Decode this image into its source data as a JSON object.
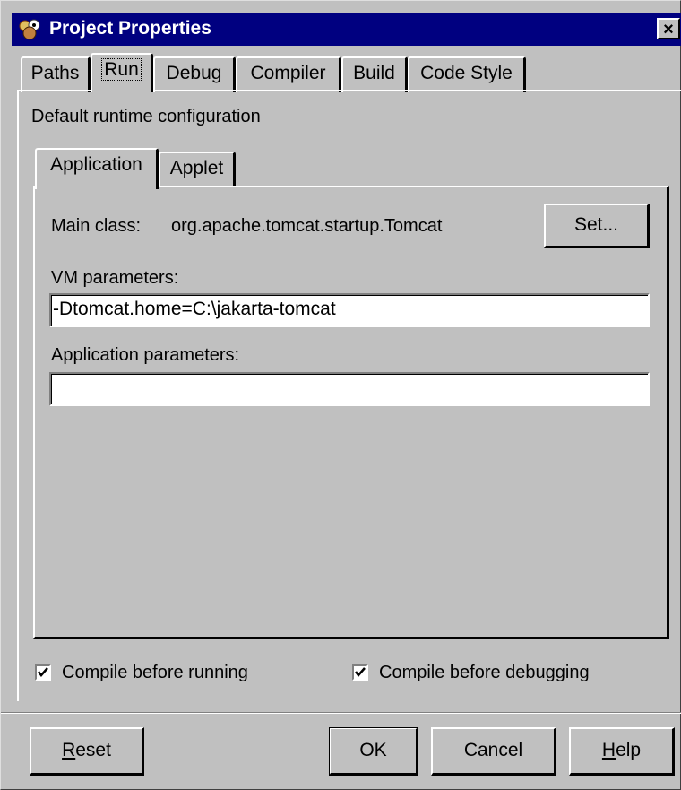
{
  "window": {
    "title": "Project Properties",
    "close_label": "×"
  },
  "tabs": [
    {
      "label": "Paths"
    },
    {
      "label": "Run"
    },
    {
      "label": "Debug"
    },
    {
      "label": "Compiler"
    },
    {
      "label": "Build"
    },
    {
      "label": "Code Style"
    }
  ],
  "run": {
    "section_label": "Default runtime configuration",
    "subtabs": [
      {
        "label": "Application"
      },
      {
        "label": "Applet"
      }
    ],
    "main_class_label": "Main class:",
    "main_class_value": "org.apache.tomcat.startup.Tomcat",
    "set_button": "Set...",
    "vm_params_label": "VM parameters:",
    "vm_params_value": "-Dtomcat.home=C:\\jakarta-tomcat",
    "app_params_label": "Application parameters:",
    "app_params_value": ""
  },
  "options": {
    "compile_before_running": {
      "label": "Compile before running",
      "checked": true
    },
    "compile_before_debugging": {
      "label": "Compile before debugging",
      "checked": true
    }
  },
  "buttons": {
    "reset_mnemonic": "R",
    "reset_rest": "eset",
    "ok": "OK",
    "cancel": "Cancel",
    "help_mnemonic": "H",
    "help_rest": "elp"
  }
}
